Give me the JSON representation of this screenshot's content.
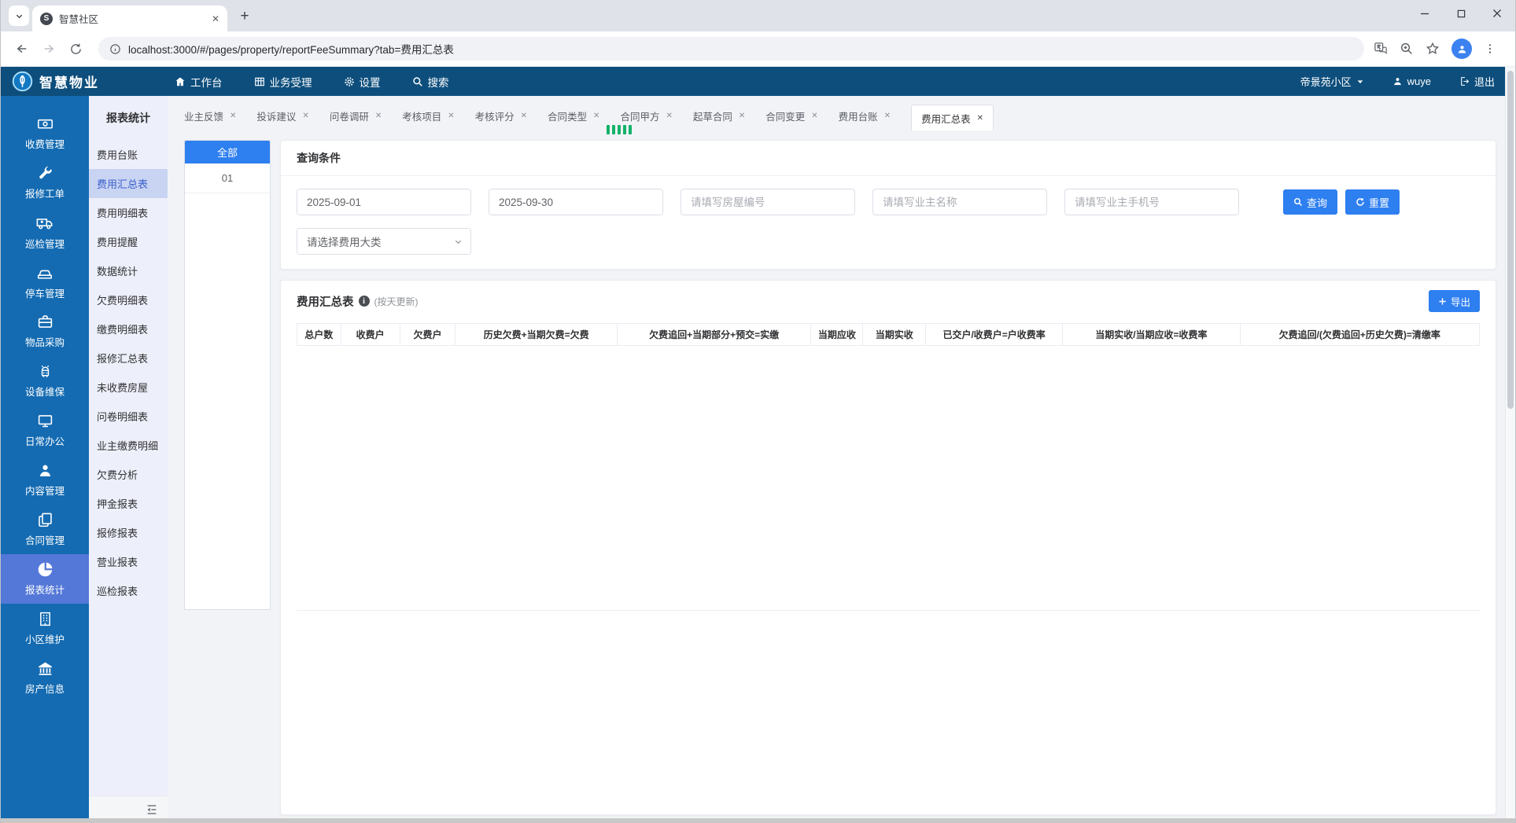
{
  "browser": {
    "tab_title": "智慧社区",
    "url": "localhost:3000/#/pages/property/reportFeeSummary?tab=费用汇总表"
  },
  "topbar": {
    "brand": "智慧物业",
    "menu": {
      "workbench": "工作台",
      "business": "业务受理",
      "settings": "设置",
      "search": "搜索"
    },
    "community": "帝景苑小区",
    "username": "wuye",
    "logout_label": "退出"
  },
  "sidebar": {
    "items": [
      {
        "label": "收费管理"
      },
      {
        "label": "报修工单"
      },
      {
        "label": "巡检管理"
      },
      {
        "label": "停车管理"
      },
      {
        "label": "物品采购"
      },
      {
        "label": "设备维保"
      },
      {
        "label": "日常办公"
      },
      {
        "label": "内容管理"
      },
      {
        "label": "合同管理"
      },
      {
        "label": "报表统计"
      },
      {
        "label": "小区维护"
      },
      {
        "label": "房产信息"
      }
    ],
    "active": "报表统计"
  },
  "submenu": {
    "title": "报表统计",
    "items": [
      "费用台账",
      "费用汇总表",
      "费用明细表",
      "费用提醒",
      "数据统计",
      "欠费明细表",
      "缴费明细表",
      "报修汇总表",
      "未收费房屋",
      "问卷明细表",
      "业主缴费明细",
      "欠费分析",
      "押金报表",
      "报修报表",
      "营业报表",
      "巡检报表"
    ],
    "active": "费用汇总表"
  },
  "tabs": {
    "items": [
      "业主反馈",
      "投诉建议",
      "问卷调研",
      "考核项目",
      "考核评分",
      "合同类型",
      "合同甲方",
      "起草合同",
      "合同变更",
      "费用台账",
      "费用汇总表"
    ],
    "active": "费用汇总表",
    "close_glyph": "✕"
  },
  "fee_panel": {
    "all_label": "全部",
    "items": [
      "01"
    ]
  },
  "query": {
    "title": "查询条件",
    "date_start": "2025-09-01",
    "date_end": "2025-09-30",
    "house_placeholder": "请填写房屋编号",
    "owner_placeholder": "请填写业主名称",
    "phone_placeholder": "请填写业主手机号",
    "fee_type_placeholder": "请选择费用大类",
    "search_label": "查询",
    "reset_label": "重置"
  },
  "report": {
    "title": "费用汇总表",
    "update_note": "(按天更新)",
    "export_label": "导出",
    "columns": [
      "总户数",
      "收费户",
      "欠费户",
      "历史欠费+当期欠费=欠费",
      "欠费追回+当期部分+预交=实缴",
      "当期应收",
      "当期实收",
      "已交户/收费户=户收费率",
      "当期实收/当期应收=收费率",
      "欠费追回/(欠费追回+历史欠费)=清缴率"
    ],
    "rows": []
  }
}
